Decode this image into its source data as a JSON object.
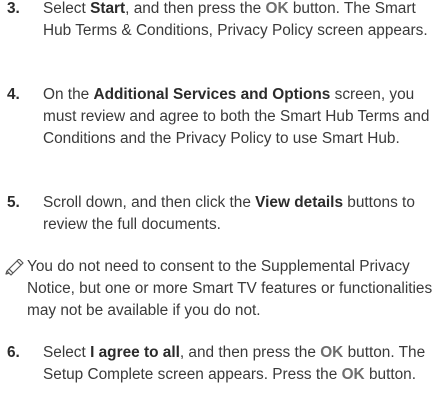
{
  "steps": [
    {
      "num": "3.",
      "t1": "Select ",
      "start": "Start",
      "t2": ", and then press the ",
      "ok": "OK",
      "t3": " button. The Smart Hub Terms & Conditions, Privacy Policy screen appears."
    },
    {
      "num": "4.",
      "t1": "On the ",
      "term": "Additional Services and Options",
      "t2": " screen, you must review and agree to both the Smart Hub Terms and Conditions and the Privacy Policy to use Smart Hub."
    },
    {
      "num": "5.",
      "t1": "Scroll down, and then click the ",
      "term": "View details",
      "t2": " buttons to review the full documents."
    },
    {
      "num": "6.",
      "t1": "Select ",
      "term": "I agree to all",
      "t2": ", and then press the ",
      "ok1": "OK",
      "t3": " button. The Setup Complete screen appears. Press the ",
      "ok2": "OK",
      "t4": " button."
    }
  ],
  "note": {
    "text": "You do not need to consent to the Supplemental Privacy Notice, but one or more Smart TV features or functionalities may not be available if you do not."
  }
}
